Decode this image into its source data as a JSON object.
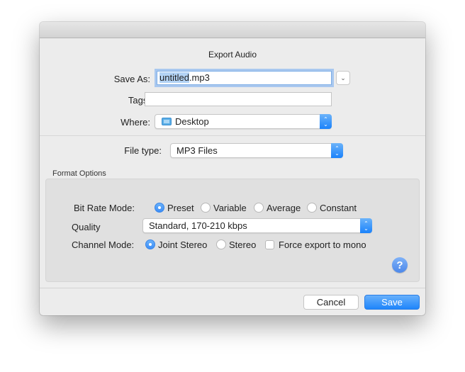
{
  "dialog": {
    "title": "Export Audio"
  },
  "save_as": {
    "label": "Save As:",
    "value_selected": "untitled",
    "value_rest": ".mp3"
  },
  "tags": {
    "label": "Tags:",
    "value": ""
  },
  "where": {
    "label": "Where:",
    "value": "Desktop",
    "icon": "folder-icon"
  },
  "file_type": {
    "label": "File type:",
    "value": "MP3 Files"
  },
  "format_options": {
    "title": "Format Options",
    "bit_rate_mode": {
      "label": "Bit Rate Mode:",
      "options": [
        "Preset",
        "Variable",
        "Average",
        "Constant"
      ],
      "selected": "Preset"
    },
    "quality": {
      "label": "Quality",
      "value": "Standard, 170-210 kbps"
    },
    "channel_mode": {
      "label": "Channel Mode:",
      "options": [
        "Joint Stereo",
        "Stereo"
      ],
      "selected": "Joint Stereo",
      "force_mono_label": "Force export to mono",
      "force_mono_checked": false
    },
    "help_label": "?"
  },
  "buttons": {
    "cancel": "Cancel",
    "save": "Save"
  },
  "colors": {
    "accent": "#1e85fb",
    "selection": "#b3d3f5"
  }
}
